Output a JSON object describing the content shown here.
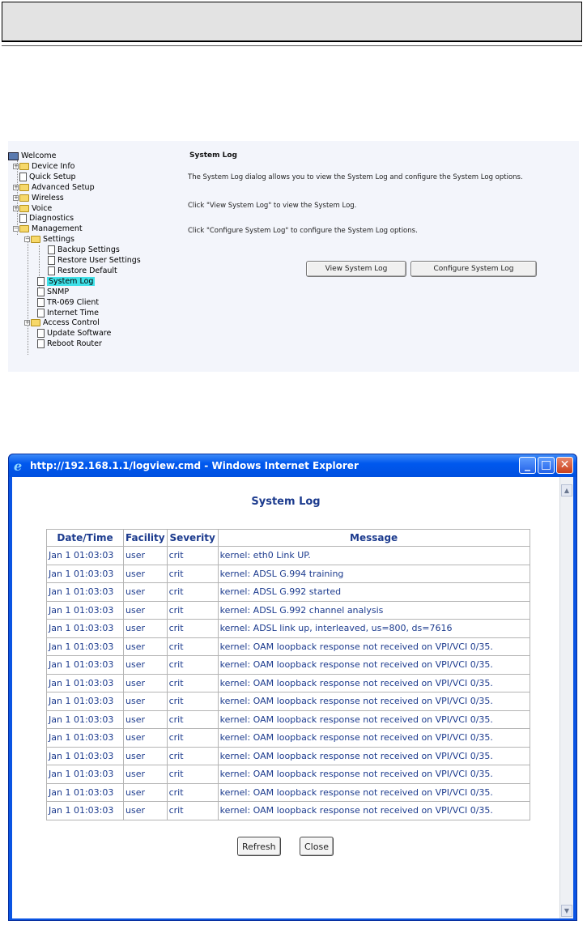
{
  "router": {
    "tree": [
      {
        "label": "Welcome",
        "icon": "computer-icon",
        "hl": false
      },
      {
        "label": "Device Info",
        "icon": "folder-icon",
        "hl": false
      },
      {
        "label": "Quick Setup",
        "icon": "page-icon",
        "hl": false
      },
      {
        "label": "Advanced Setup",
        "icon": "folder-icon",
        "hl": false
      },
      {
        "label": "Wireless",
        "icon": "folder-icon",
        "hl": false
      },
      {
        "label": "Voice",
        "icon": "folder-icon",
        "hl": false
      },
      {
        "label": "Diagnostics",
        "icon": "page-icon",
        "hl": false
      },
      {
        "label": "Management",
        "icon": "folder-open-icon",
        "hl": false
      },
      {
        "label": "Settings",
        "icon": "folder-open-icon",
        "hl": false
      },
      {
        "label": "Backup Settings",
        "icon": "page-icon",
        "hl": false
      },
      {
        "label": "Restore User Settings",
        "icon": "page-icon",
        "hl": false
      },
      {
        "label": "Restore Default",
        "icon": "page-icon",
        "hl": false
      },
      {
        "label": "System Log",
        "icon": "page-icon",
        "hl": true
      },
      {
        "label": "SNMP",
        "icon": "page-icon",
        "hl": false
      },
      {
        "label": "TR-069 Client",
        "icon": "page-icon",
        "hl": false
      },
      {
        "label": "Internet Time",
        "icon": "page-icon",
        "hl": false
      },
      {
        "label": "Access Control",
        "icon": "folder-icon",
        "hl": false
      },
      {
        "label": "Update Software",
        "icon": "page-icon",
        "hl": false
      },
      {
        "label": "Reboot Router",
        "icon": "page-icon",
        "hl": false
      }
    ],
    "page_title": "System Log",
    "paragraphs": [
      "The System Log dialog allows you to view the System Log and configure the System Log options.",
      "Click \"View System Log\" to view the System Log.",
      "Click \"Configure System Log\" to configure the System Log options."
    ],
    "view_button": "View System Log",
    "configure_button": "Configure System Log"
  },
  "ie": {
    "logo": "e",
    "title": "http://192.168.1.1/logview.cmd - Windows Internet Explorer",
    "minimize": "_",
    "maximize": "□",
    "close": "✕",
    "scroll_up": "▲",
    "scroll_down": "▼",
    "log_title": "System Log",
    "columns": [
      "Date/Time",
      "Facility",
      "Severity",
      "Message"
    ],
    "rows": [
      [
        "Jan 1 01:03:03",
        "user",
        "crit",
        "kernel: eth0 Link UP."
      ],
      [
        "Jan 1 01:03:03",
        "user",
        "crit",
        "kernel: ADSL G.994 training"
      ],
      [
        "Jan 1 01:03:03",
        "user",
        "crit",
        "kernel: ADSL G.992 started"
      ],
      [
        "Jan 1 01:03:03",
        "user",
        "crit",
        "kernel: ADSL G.992 channel analysis"
      ],
      [
        "Jan 1 01:03:03",
        "user",
        "crit",
        "kernel: ADSL link up, interleaved, us=800, ds=7616"
      ],
      [
        "Jan 1 01:03:03",
        "user",
        "crit",
        "kernel: OAM loopback response not received on VPI/VCI 0/35."
      ],
      [
        "Jan 1 01:03:03",
        "user",
        "crit",
        "kernel: OAM loopback response not received on VPI/VCI 0/35."
      ],
      [
        "Jan 1 01:03:03",
        "user",
        "crit",
        "kernel: OAM loopback response not received on VPI/VCI 0/35."
      ],
      [
        "Jan 1 01:03:03",
        "user",
        "crit",
        "kernel: OAM loopback response not received on VPI/VCI 0/35."
      ],
      [
        "Jan 1 01:03:03",
        "user",
        "crit",
        "kernel: OAM loopback response not received on VPI/VCI 0/35."
      ],
      [
        "Jan 1 01:03:03",
        "user",
        "crit",
        "kernel: OAM loopback response not received on VPI/VCI 0/35."
      ],
      [
        "Jan 1 01:03:03",
        "user",
        "crit",
        "kernel: OAM loopback response not received on VPI/VCI 0/35."
      ],
      [
        "Jan 1 01:03:03",
        "user",
        "crit",
        "kernel: OAM loopback response not received on VPI/VCI 0/35."
      ],
      [
        "Jan 1 01:03:03",
        "user",
        "crit",
        "kernel: OAM loopback response not received on VPI/VCI 0/35."
      ],
      [
        "Jan 1 01:03:03",
        "user",
        "crit",
        "kernel: OAM loopback response not received on VPI/VCI 0/35."
      ]
    ],
    "refresh_button": "Refresh",
    "close_button": "Close"
  }
}
